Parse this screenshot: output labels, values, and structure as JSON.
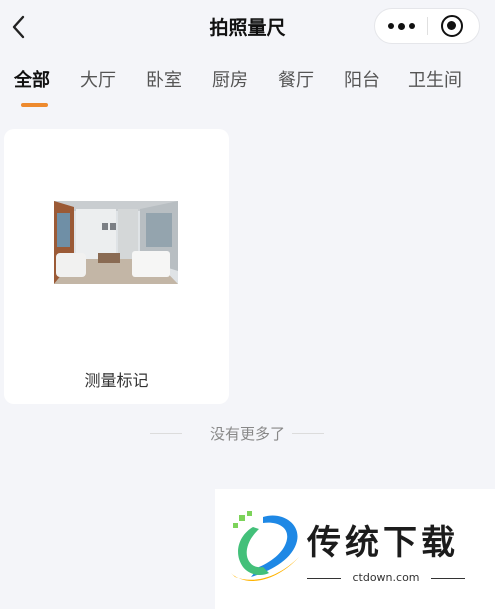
{
  "header": {
    "title": "拍照量尺"
  },
  "tabs": [
    {
      "label": "全部",
      "active": true
    },
    {
      "label": "大厅",
      "active": false
    },
    {
      "label": "卧室",
      "active": false
    },
    {
      "label": "厨房",
      "active": false
    },
    {
      "label": "餐厅",
      "active": false
    },
    {
      "label": "阳台",
      "active": false
    },
    {
      "label": "卫生间",
      "active": false
    }
  ],
  "cards": [
    {
      "label": "测量标记"
    }
  ],
  "end_text": "没有更多了",
  "watermark": {
    "name": "传统下载",
    "domain": "ctdown.com"
  },
  "colors": {
    "accent": "#ee8a2e",
    "background": "#f4f5f9"
  }
}
